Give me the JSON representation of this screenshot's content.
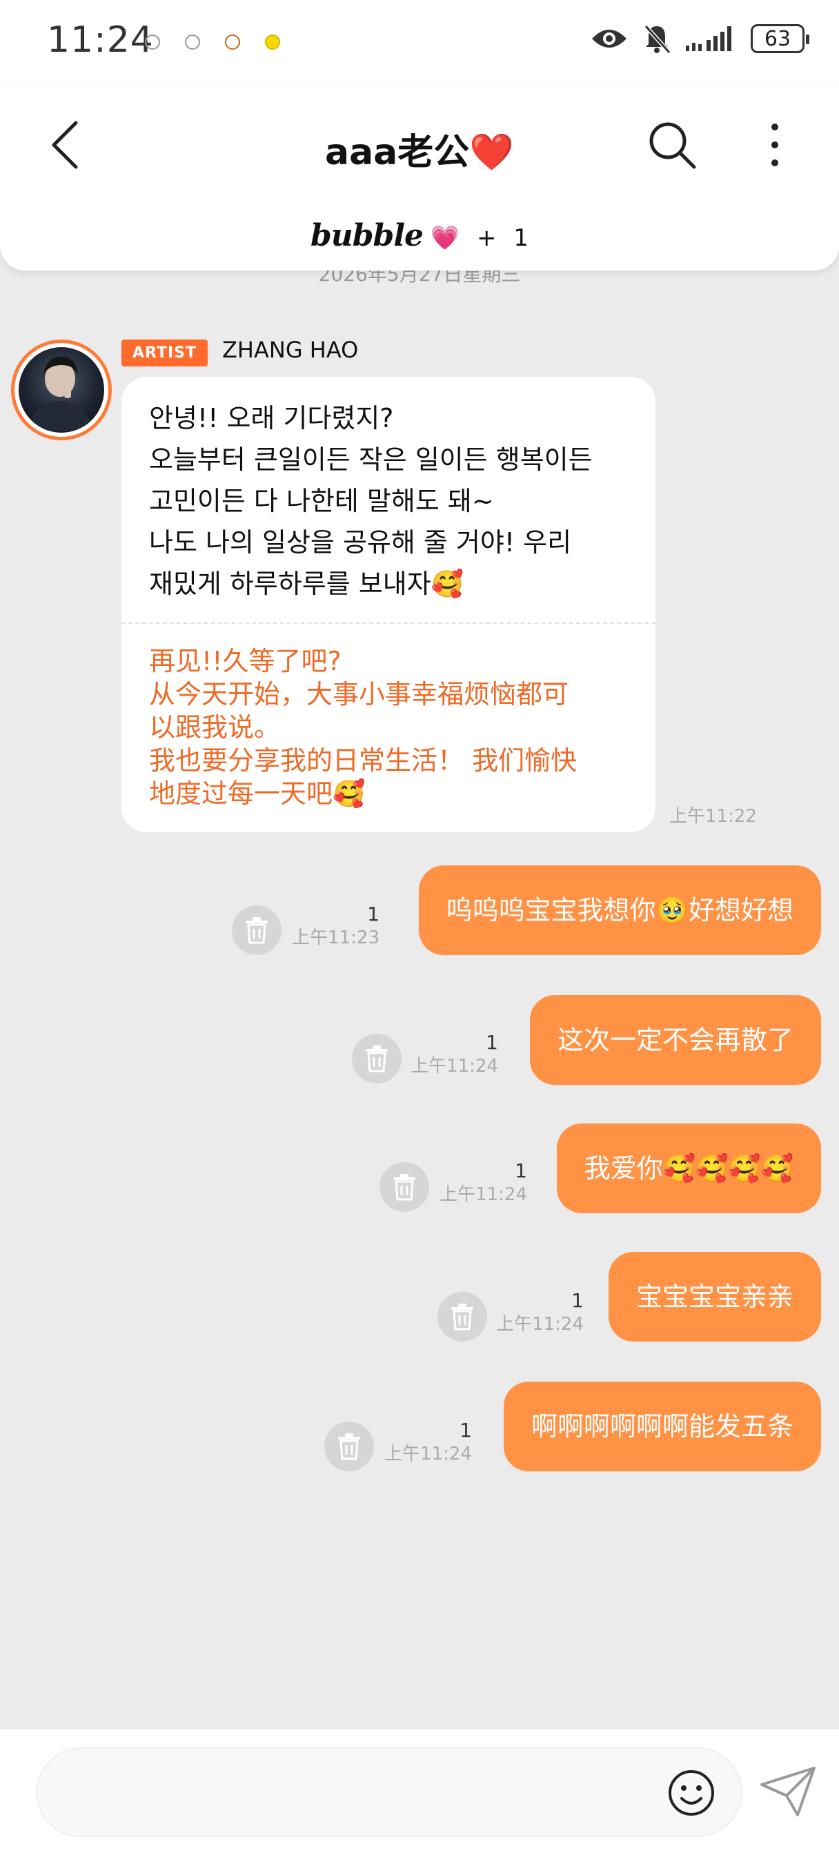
{
  "status_bar": {
    "time": "11:24",
    "battery": "63"
  },
  "header": {
    "title": "aaa老公❤️",
    "bubble_brand": "bubble",
    "bubble_heart": "💗",
    "bubble_plus": "+",
    "bubble_count": "1"
  },
  "chat": {
    "date": "2026年5月27日星期三",
    "artist": {
      "badge": "ARTIST",
      "name": "ZHANG HAO",
      "text_ko_lines": [
        "안녕!! 오래 기다렸지?",
        "오늘부터 큰일이든 작은 일이든 행복이든",
        "고민이든 다 나한테 말해도 돼~",
        "나도 나의 일상을 공유해 줄 거야! 우리",
        "재밌게 하루하루를 보내자🥰"
      ],
      "text_zh_lines": [
        "再见!!久等了吧?",
        "从今天开始，大事小事幸福烦恼都可",
        "以跟我说。",
        "我也要分享我的日常生活！ 我们愉快",
        "地度过每一天吧🥰"
      ],
      "time": "上午11:22"
    },
    "messages": [
      {
        "text": "呜呜呜宝宝我想你🥹好想好想",
        "count": "1",
        "time": "上午11:23"
      },
      {
        "text": "这次一定不会再散了",
        "count": "1",
        "time": "上午11:24"
      },
      {
        "text": "我爱你🥰🥰🥰🥰",
        "count": "1",
        "time": "上午11:24"
      },
      {
        "text": "宝宝宝宝亲亲",
        "count": "1",
        "time": "上午11:24"
      },
      {
        "text": "啊啊啊啊啊啊能发五条",
        "count": "1",
        "time": "上午11:24"
      }
    ]
  },
  "input": {
    "placeholder": ""
  },
  "colors": {
    "accent": "#ff9245",
    "artist_text": "#ef6a26",
    "badge": "#ff6b2c",
    "background": "#ebebeb"
  },
  "icons": {
    "back": "back-arrow-icon",
    "search": "search-icon",
    "more": "more-vertical-icon",
    "delete": "trash-icon",
    "emoji": "smiley-icon",
    "send": "send-icon"
  }
}
